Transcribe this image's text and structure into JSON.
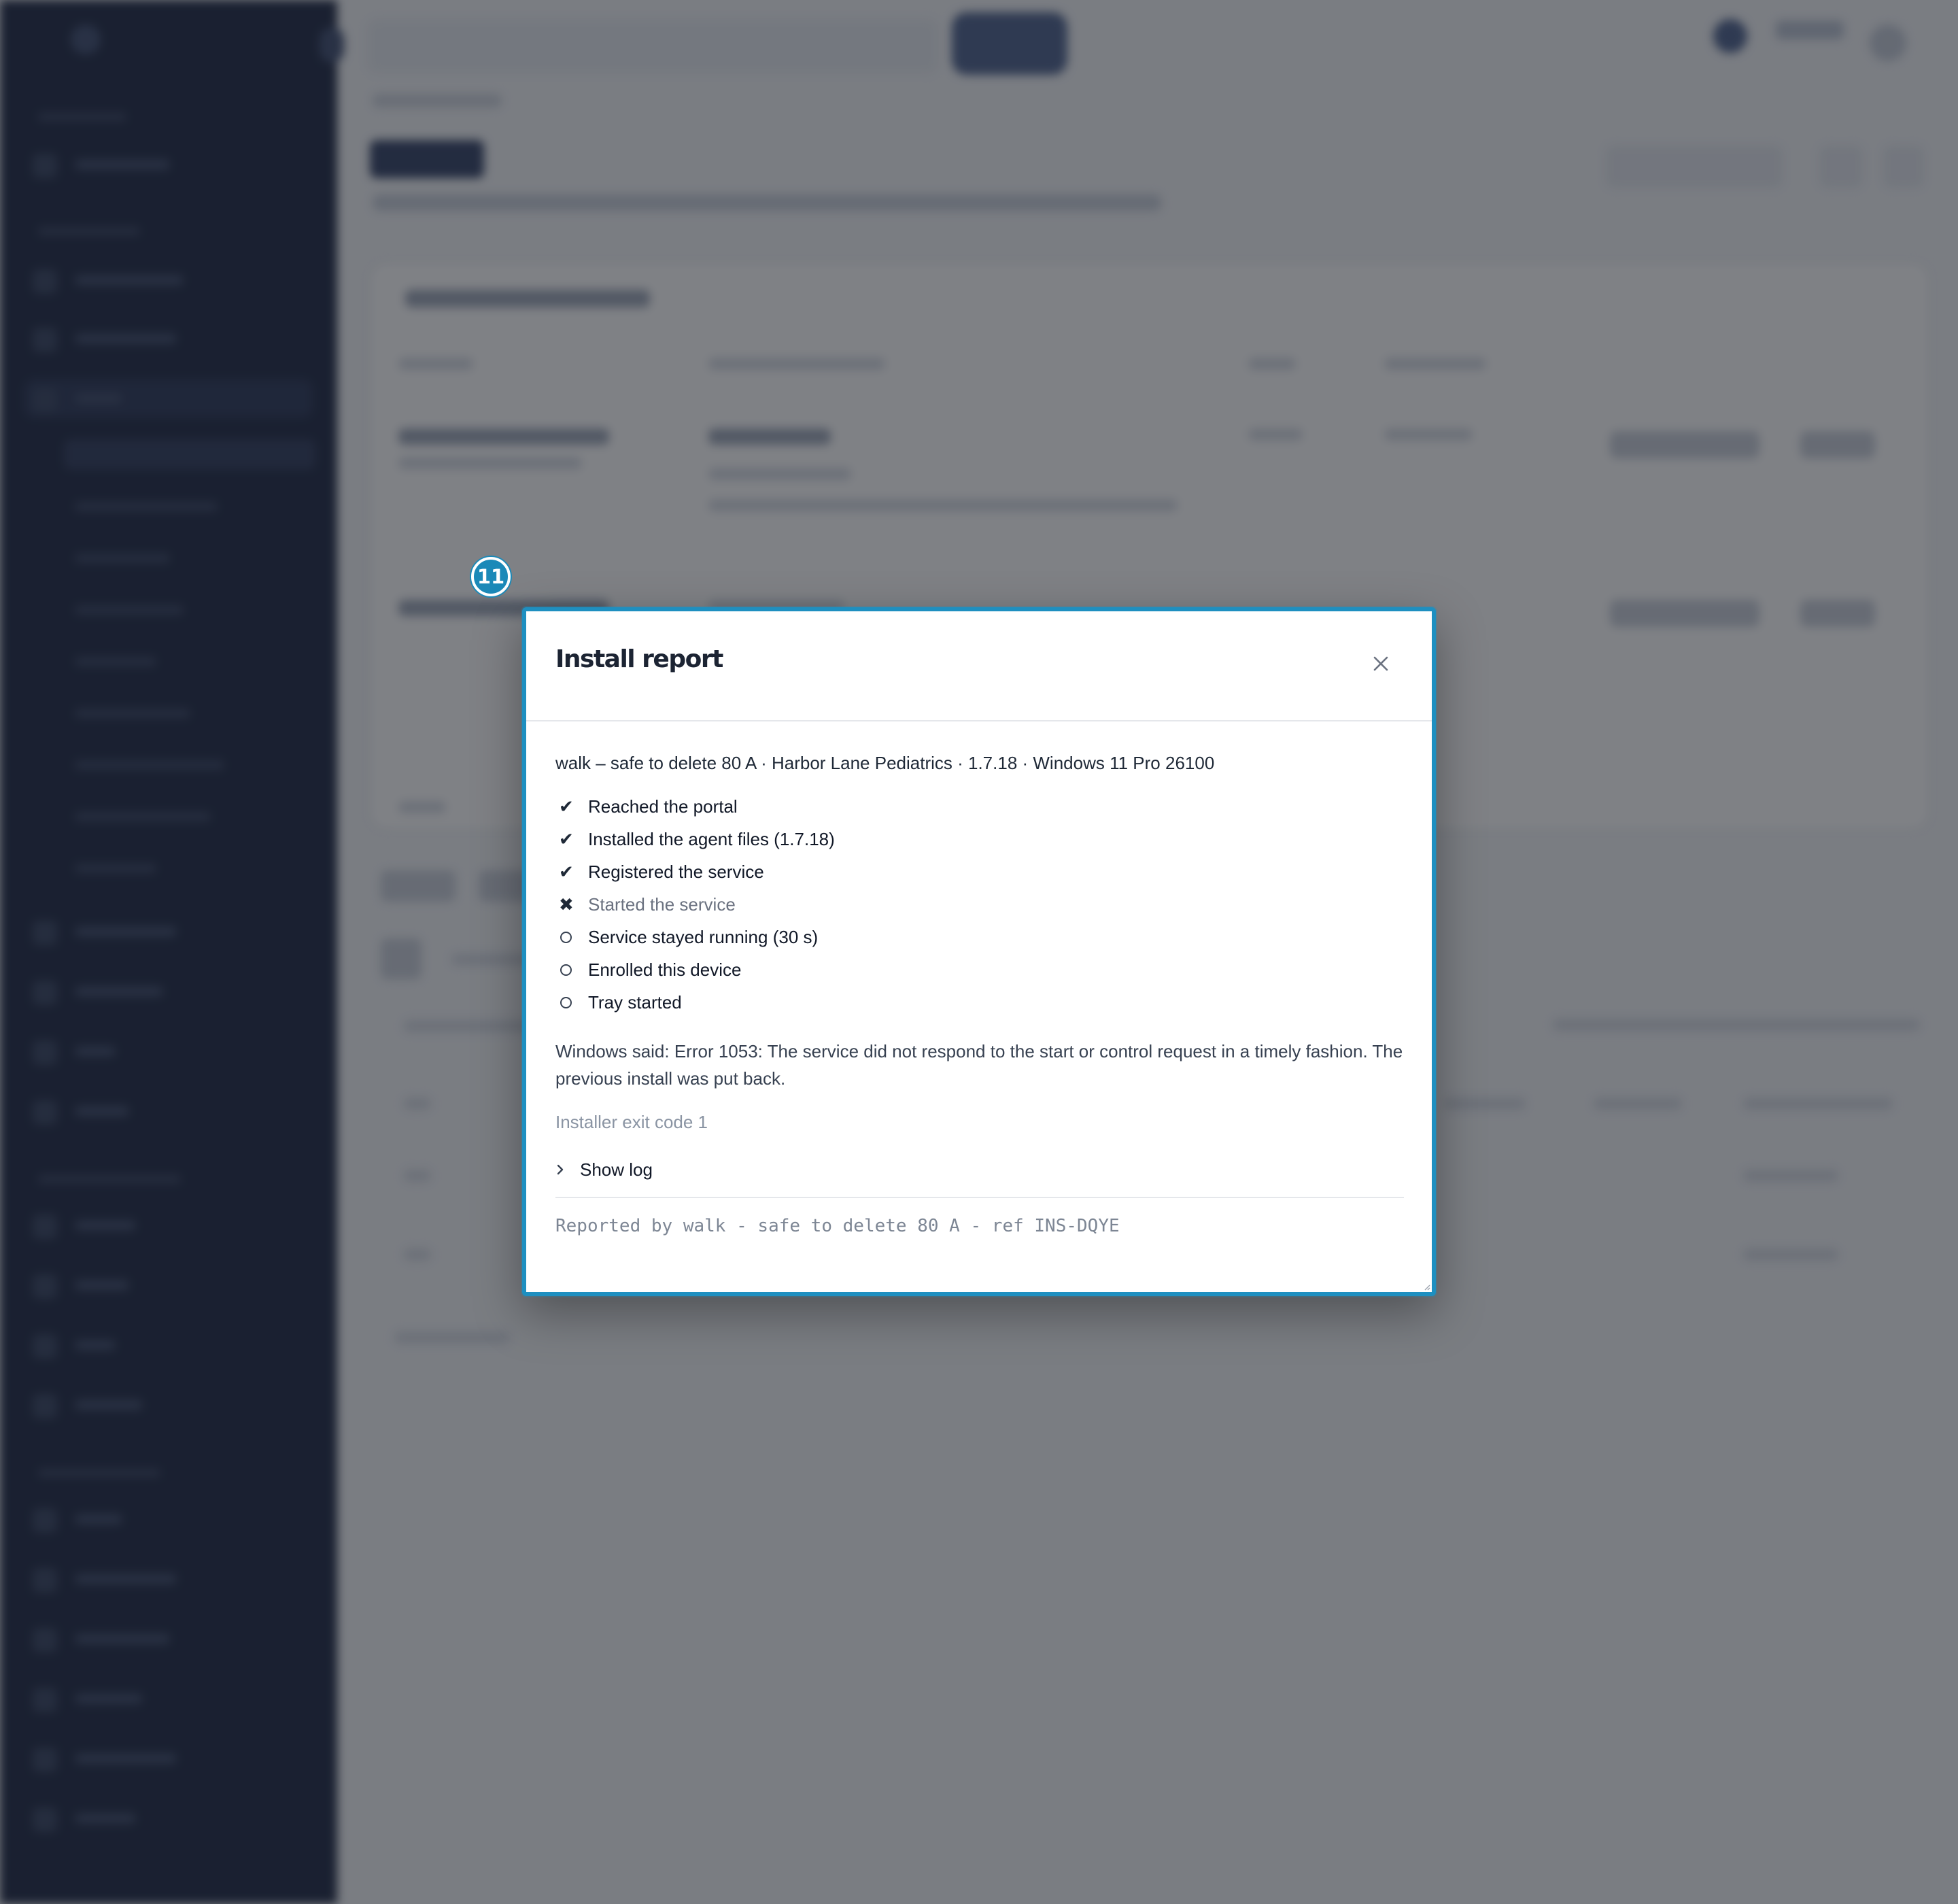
{
  "badge": {
    "number": "11"
  },
  "modal": {
    "title": "Install report",
    "close_icon": "close-icon",
    "meta_line": "walk – safe to delete 80 A · Harbor Lane Pediatrics · 1.7.18 · Windows 11 Pro 26100",
    "steps": [
      {
        "label": "Reached the portal",
        "status": "done",
        "icon": "✔"
      },
      {
        "label": "Installed the agent files (1.7.18)",
        "status": "done",
        "icon": "✔"
      },
      {
        "label": "Registered the service",
        "status": "done",
        "icon": "✔"
      },
      {
        "label": "Started the service",
        "status": "failed",
        "icon": "✖"
      },
      {
        "label": "Service stayed running (30 s)",
        "status": "pending",
        "icon": "○"
      },
      {
        "label": "Enrolled this device",
        "status": "pending",
        "icon": "○"
      },
      {
        "label": "Tray started",
        "status": "pending",
        "icon": "○"
      }
    ],
    "error_message": "Windows said: Error 1053: The service did not respond to the start or control request in a timely fashion. The previous install was put back.",
    "exit_code": "Installer exit code 1",
    "show_log_label": "Show log",
    "footer_ref": "Reported by walk - safe to delete 80 A - ref INS-DQYE"
  },
  "colors": {
    "accent": "#1e8fc0",
    "sidebar": "#1a2440",
    "overlay": "rgba(27,30,38,0.56)"
  }
}
